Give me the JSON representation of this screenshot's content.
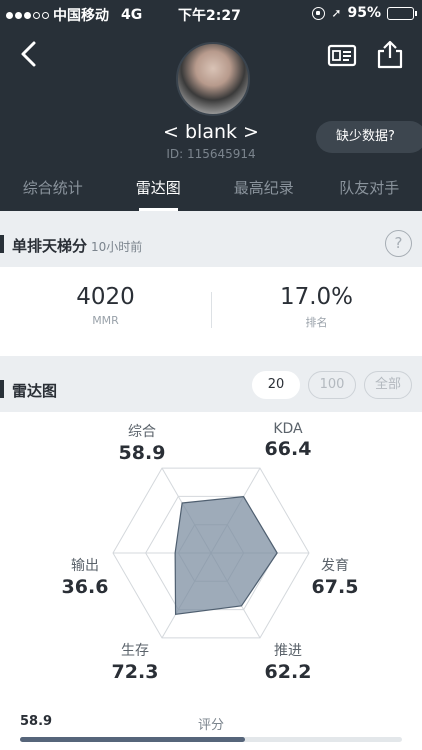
{
  "status_bar": {
    "carrier": "中国移动",
    "network": "4G",
    "time": "下午2:27",
    "battery": "95%",
    "battery_level": 0.95
  },
  "profile": {
    "username": "< blank >",
    "user_id": "ID: 115645914",
    "missing_data_label": "缺少数据?"
  },
  "tabs": [
    {
      "label": "综合统计"
    },
    {
      "label": "雷达图",
      "active": true
    },
    {
      "label": "最高纪录"
    },
    {
      "label": "队友对手"
    }
  ],
  "ladder": {
    "title": "单排天梯分",
    "updated": "10小时前",
    "help": "?",
    "mmr_value": "4020",
    "mmr_label": "MMR",
    "rank_value": "17.0%",
    "rank_label": "排名"
  },
  "radar_section": {
    "title": "雷达图",
    "ranges": [
      "20",
      "100",
      "全部"
    ],
    "selected_range": "20"
  },
  "radar": {
    "axes": [
      {
        "name": "综合",
        "value": "58.9",
        "score": 58.9
      },
      {
        "name": "KDA",
        "value": "66.4",
        "score": 66.4
      },
      {
        "name": "发育",
        "value": "67.5",
        "score": 67.5
      },
      {
        "name": "推进",
        "value": "62.2",
        "score": 62.2
      },
      {
        "name": "生存",
        "value": "72.3",
        "score": 72.3
      },
      {
        "name": "输出",
        "value": "36.6",
        "score": 36.6
      }
    ],
    "max": 100
  },
  "score": {
    "value": "58.9",
    "label": "评分",
    "fraction": 0.589
  },
  "colors": {
    "header_bg": "#283038",
    "radar_fill": "#7e8fa1",
    "radar_stroke": "#4f5f70",
    "score_fill": "#56657a"
  }
}
